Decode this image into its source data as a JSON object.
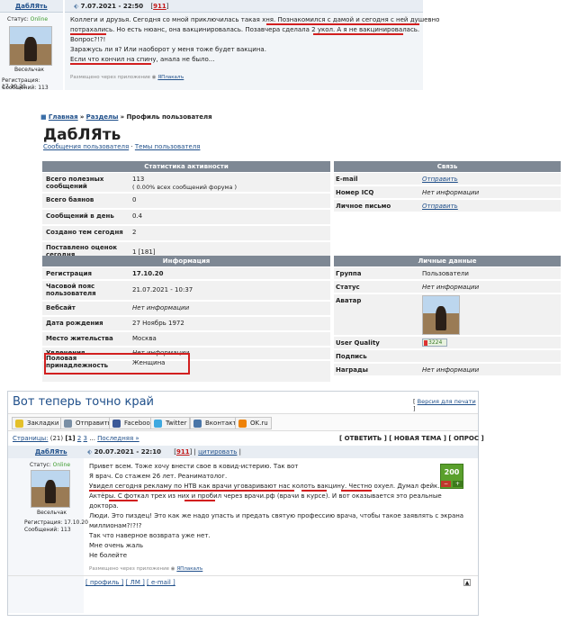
{
  "post1": {
    "author": "ДабЛЯть",
    "date": "7.07.2021 - 22:50",
    "post_number": "911",
    "status_label": "Статус:",
    "status_value": "Online",
    "rank": "Весельчак",
    "reg": "Регистрация: 17.10.20",
    "msgs": "Сообщений: 113",
    "lines": [
      "Коллеги и друзья. Сегодня со мной приключилась такая хня. Познакомился с дамой и сегодня с ней душевно",
      "потрахались. Но есть нюанс, она вакцинировалась. Позавчера сделала 2 укол. А я не вакцинировалась.",
      "Вопрос?!?!",
      "Заражусь ли я? Или наоборот у меня тоже будет вакцина.",
      "Если что кончил на спину, анала не было..."
    ],
    "footer": "Размещено через приложение",
    "footer_link": "ЯПлакалъ"
  },
  "profile": {
    "breadcrumb_home": "Главная",
    "breadcrumb_sections": "Разделы",
    "breadcrumb_current": "Профиль пользователя",
    "sep": "»",
    "name": "ДабЛЯть",
    "link_posts": "Сообщения пользователя",
    "link_sep": "·",
    "link_topics": "Темы пользователя",
    "activity_title": "Статистика активности",
    "activity": [
      {
        "label": "Всего полезных сообщений",
        "value": "113",
        "note": "( 0.00% всех сообщений форума )"
      },
      {
        "label": "Всего баянов",
        "value": "0"
      },
      {
        "label": "Сообщений в день",
        "value": "0.4"
      },
      {
        "label": "Создано тем сегодня",
        "value": "2"
      },
      {
        "label": "Поставлено оценок сегодня",
        "value": "1 [181]"
      }
    ],
    "contact_title": "Связь",
    "contact": [
      {
        "label": "E-mail",
        "value": "Отправить"
      },
      {
        "label": "Номер ICQ",
        "value": "Нет информации"
      },
      {
        "label": "Личное письмо",
        "value": "Отправить"
      }
    ],
    "info_title": "Информация",
    "info": [
      {
        "label": "Регистрация",
        "value": "17.10.20"
      },
      {
        "label": "Часовой пояс пользователя",
        "value": "21.07.2021 - 10:37"
      },
      {
        "label": "Вебсайт",
        "value": "Нет информации"
      },
      {
        "label": "Дата рождения",
        "value": "27 Ноябрь 1972"
      },
      {
        "label": "Место жительства",
        "value": "Москва"
      },
      {
        "label": "Увлечения",
        "value": "Нет информации"
      },
      {
        "label": "Половая принадлежность",
        "value": "Женщина"
      }
    ],
    "personal_title": "Личные данные",
    "personal": [
      {
        "label": "Группа",
        "value": "Пользователи"
      },
      {
        "label": "Статус",
        "value": "Нет информации"
      },
      {
        "label": "Аватар",
        "value": ""
      },
      {
        "label": "User Quality",
        "value": "3224"
      },
      {
        "label": "Подпись",
        "value": ""
      },
      {
        "label": "Награды",
        "value": "Нет информации"
      }
    ]
  },
  "thread": {
    "title": "Вот теперь точно край",
    "print_link": "Версия для печати",
    "share": [
      "Закладки",
      "Отправить",
      "Facebook",
      "Twitter",
      "Вконтакте",
      "OK.ru"
    ],
    "pages_label": "Страницы:",
    "pages_count": "(21)",
    "pages": [
      "1",
      "2",
      "3"
    ],
    "pages_dots": "...",
    "pages_last": "Последняя »",
    "reply_btn": "[ ОТВЕТИТЬ ]",
    "newtopic_btn": "[ НОВАЯ ТЕМА ]",
    "poll_btn": "[ ОПРОС ]",
    "author": "ДабЛЯть",
    "date": "20.07.2021 - 22:10",
    "post_number": "911",
    "quote": "цитировать",
    "status_label": "Статус:",
    "status_value": "Online",
    "rank": "Весельчак",
    "reg": "Регистрация: 17.10.20",
    "msgs": "Сообщений: 113",
    "rating": "200",
    "lines": [
      "Привет всем. Тоже хочу внести свое в ковид-истерию. Так вот",
      "Я врач. Со стажем 26 лет. Реаниматолог.",
      "Увидел сегодня рекламу по НТВ как врачи уговаривают нас колоть вакцину. Честно охуел. Думал фейк.",
      "Актёры. С фоткал трех из них и пробил через врачи.рф (врачи в курсе). И вот оказывается это реальные",
      "доктора.",
      "Люди. Это пиздец! Это как же надо упасть и предать святую профессию врача, чтобы такое заявлять с экрана",
      "миллионам?!?!?",
      "Так что наверное возврата уже нет.",
      "Мне очень жаль",
      "Не болейте"
    ],
    "footer": "Размещено через приложение",
    "footer_link": "ЯПлакалъ",
    "actions": [
      "[ профиль ]",
      "[ ЛМ ]",
      "[ e-mail ]"
    ]
  },
  "colors": {
    "red": "#d21f1f",
    "link": "#1f4f8a",
    "header_gray": "#7e8894",
    "green": "#5aa02c"
  }
}
